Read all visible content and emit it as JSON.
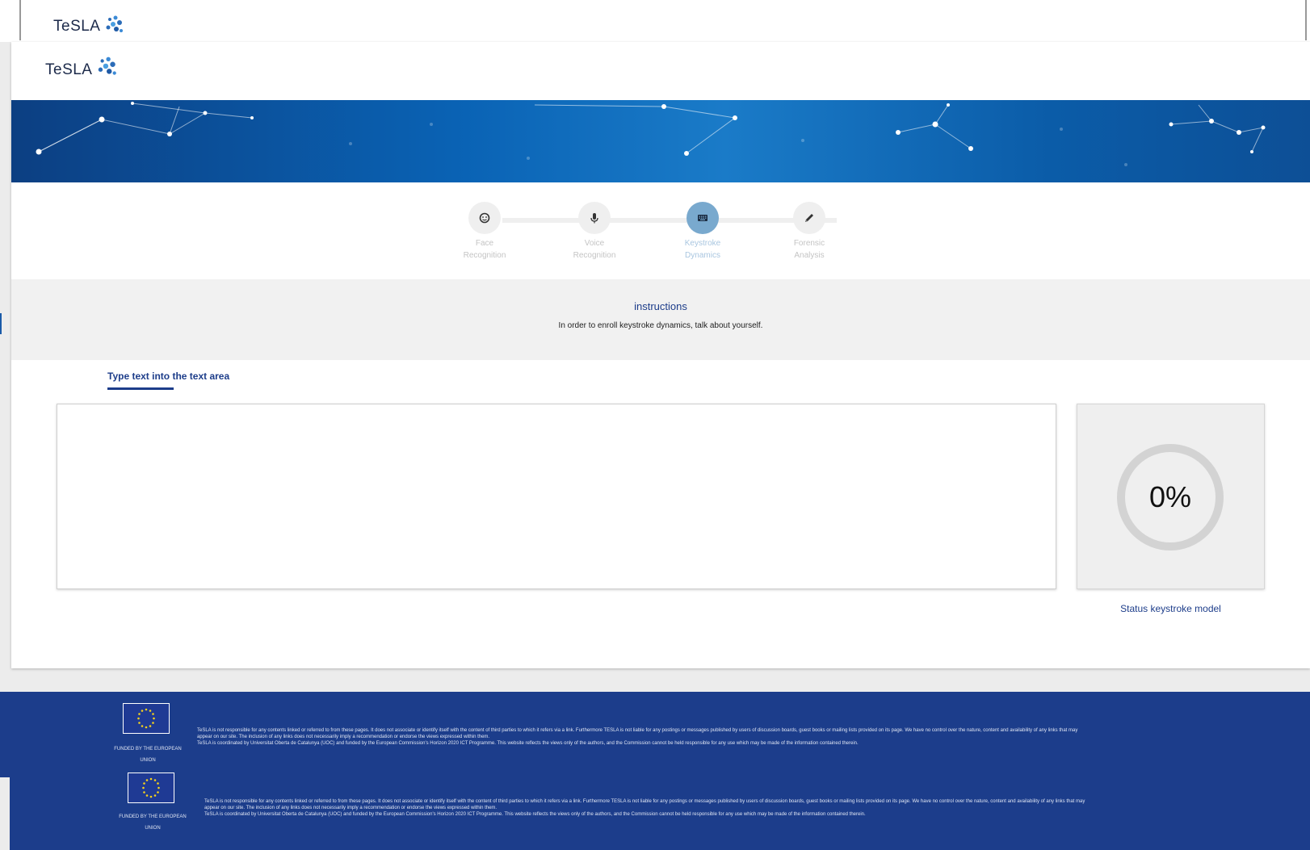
{
  "brand": {
    "name": "TeSLA",
    "tagline": ""
  },
  "steps": [
    {
      "line1": "Face",
      "line2": "Recognition",
      "icon": "face-icon",
      "active": false
    },
    {
      "line1": "Voice",
      "line2": "Recognition",
      "icon": "microphone-icon",
      "active": false
    },
    {
      "line1": "Keystroke",
      "line2": "Dynamics",
      "icon": "keyboard-icon",
      "active": true
    },
    {
      "line1": "Forensic",
      "line2": "Analysis",
      "icon": "pen-icon",
      "active": false
    }
  ],
  "instructions": {
    "title": "instructions",
    "text": "In order to enroll keystroke dynamics, talk about yourself."
  },
  "tab": {
    "label": "Type text into the text area"
  },
  "editor": {
    "value": "",
    "placeholder": ""
  },
  "status": {
    "percent_text": "0%",
    "percent": 0,
    "label": "Status keystroke model"
  },
  "footer": {
    "funded_line1": "FUNDED BY THE EUROPEAN",
    "funded_line2": "UNION",
    "disclaimer_line1": "TeSLA is not responsible for any contents linked or referred to from these pages. It does not associate or identify itself with the content of third parties to which it refers via a link. Furthermore TESLA is not liable for any postings or messages published by users of discussion boards, guest books or mailing lists provided on its page. We have no control over the nature, content and availability of any links that may",
    "disclaimer_line2": "appear on our site. The inclusion of any links does not necessarily imply a recommendation or endorse the views expressed within them.",
    "disclaimer_line3": "TeSLA is coordinated by Universitat Oberta de Catalunya (UOC) and funded by the European Commission's Horizon 2020 ICT Programme. This website reflects the views only of the authors, and the Commission cannot be held responsible for any use which may be made of the information contained therein."
  },
  "colors": {
    "primary": "#1d3d8a",
    "footer_bg": "#1c3d8b",
    "active_step": "#79a9ce",
    "banner": "#0a63b5"
  }
}
